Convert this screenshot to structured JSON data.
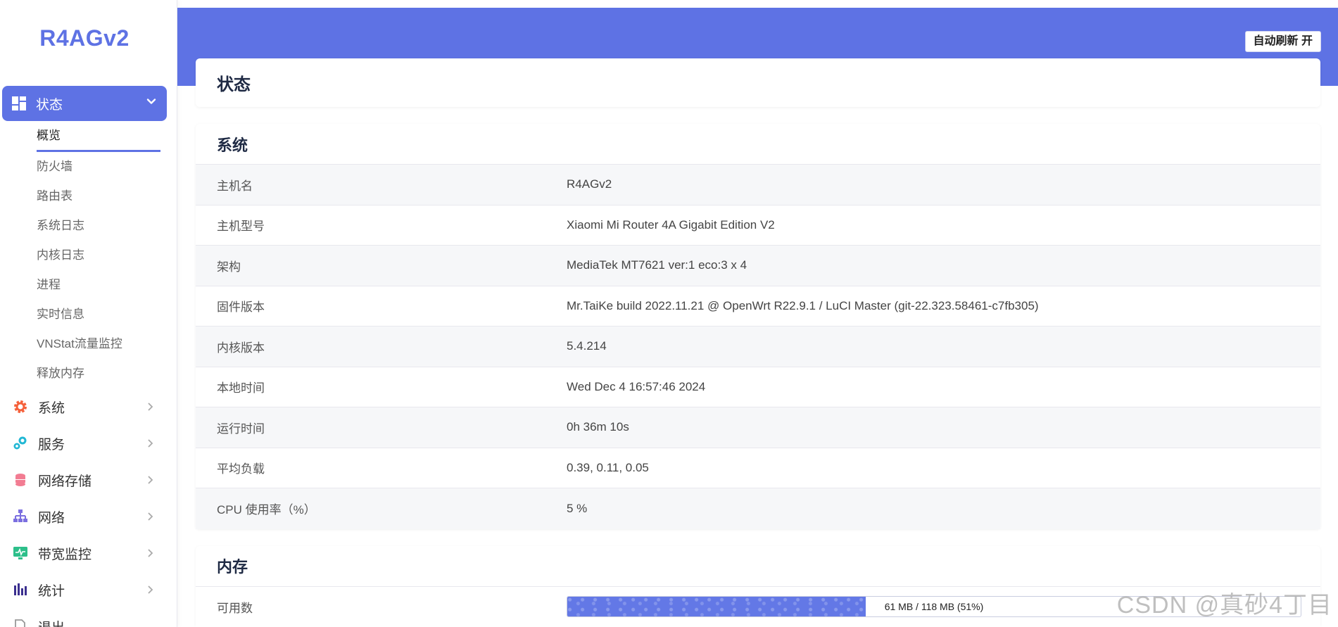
{
  "brand": "R4AGv2",
  "sidebar": {
    "active_menu": "状态",
    "sub_items": [
      "概览",
      "防火墙",
      "路由表",
      "系统日志",
      "内核日志",
      "进程",
      "实时信息",
      "VNStat流量监控",
      "释放内存"
    ],
    "menu_items": [
      {
        "label": "系统",
        "icon": "gear-icon"
      },
      {
        "label": "服务",
        "icon": "services-icon"
      },
      {
        "label": "网络存储",
        "icon": "database-icon"
      },
      {
        "label": "网络",
        "icon": "sitemap-icon"
      },
      {
        "label": "带宽监控",
        "icon": "monitor-icon"
      },
      {
        "label": "统计",
        "icon": "bar-chart-icon"
      },
      {
        "label": "退出",
        "icon": "logout-icon"
      }
    ]
  },
  "header": {
    "refresh_label": "自动刷新 开"
  },
  "page_title": "状态",
  "system": {
    "title": "系统",
    "rows": [
      {
        "key": "主机名",
        "value": "R4AGv2"
      },
      {
        "key": "主机型号",
        "value": "Xiaomi Mi Router 4A Gigabit Edition V2"
      },
      {
        "key": "架构",
        "value": "MediaTek MT7621 ver:1 eco:3 x 4"
      },
      {
        "key": "固件版本",
        "value": "Mr.TaiKe build 2022.11.21 @ OpenWrt R22.9.1 / LuCI Master (git-22.323.58461-c7fb305)"
      },
      {
        "key": "内核版本",
        "value": "5.4.214"
      },
      {
        "key": "本地时间",
        "value": "Wed Dec 4 16:57:46 2024"
      },
      {
        "key": "运行时间",
        "value": "0h 36m 10s"
      },
      {
        "key": "平均负载",
        "value": "0.39, 0.11, 0.05"
      },
      {
        "key": "CPU 使用率（%）",
        "value": "5 %"
      }
    ]
  },
  "memory": {
    "title": "内存",
    "available": {
      "key": "可用数",
      "text": "61 MB / 118 MB (51%)",
      "fraction": 0.407
    }
  },
  "watermark": "CSDN @真砂4丁目",
  "colors": {
    "accent": "#5e72e4"
  }
}
